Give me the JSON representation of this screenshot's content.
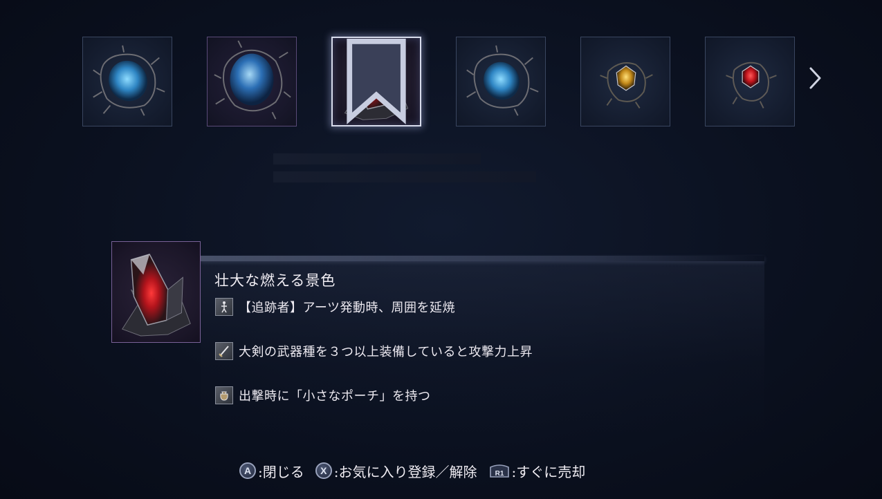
{
  "inventory": {
    "slots": [
      {
        "name": "blue-relic",
        "selected": false,
        "favorite": false
      },
      {
        "name": "blue-relic-large",
        "selected": false,
        "favorite": false
      },
      {
        "name": "red-crystal-relic",
        "selected": true,
        "favorite": true
      },
      {
        "name": "blue-relic",
        "selected": false,
        "favorite": false
      },
      {
        "name": "yellow-relic",
        "selected": false,
        "favorite": false
      },
      {
        "name": "red-relic",
        "selected": false,
        "favorite": false
      }
    ],
    "next_icon": "chevron-right-icon"
  },
  "detail": {
    "name": "壮大な燃える景色",
    "effects": [
      {
        "icon": "figure-icon",
        "text": "【追跡者】アーツ発動時、周囲を延焼"
      },
      {
        "icon": "sword-icon",
        "text": "大剣の武器種を３つ以上装備していると攻撃力上昇"
      },
      {
        "icon": "pouch-icon",
        "text": "出撃時に「小さなポーチ」を持つ"
      }
    ]
  },
  "footer": {
    "close_button": "A",
    "close_label": ":閉じる",
    "favorite_button": "X",
    "favorite_label": ":お気に入り登録／解除",
    "sell_button": "R1",
    "sell_label": ":すぐに売却"
  },
  "colors": {
    "accent_red": "#e0202a",
    "accent_blue": "#3ea6e0",
    "accent_yellow": "#d9a52a",
    "selected_border": "#d8dcec"
  }
}
